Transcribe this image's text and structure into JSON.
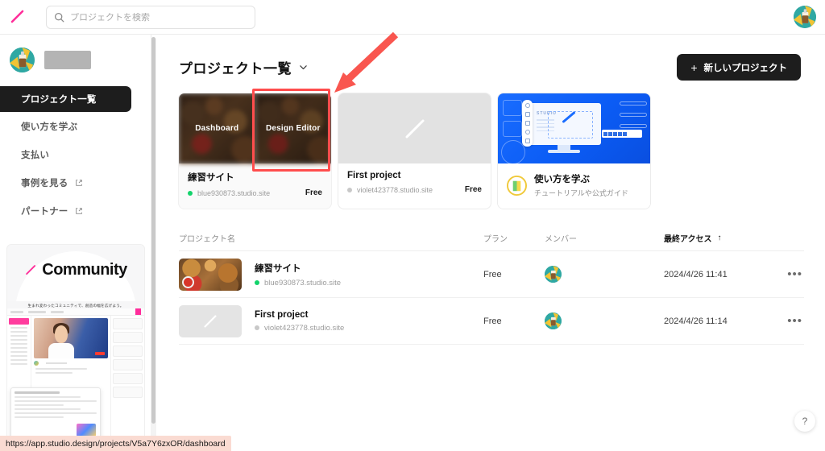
{
  "topbar": {
    "logo_icon": "studio-slash-logo",
    "search": {
      "placeholder": "プロジェクトを検索",
      "value": "",
      "icon": "search-icon"
    },
    "account_avatar": "user-avatar"
  },
  "sidebar": {
    "profile": {
      "avatar": "user-avatar",
      "name_redacted": ""
    },
    "items": [
      {
        "label": "プロジェクト一覧",
        "active": true,
        "external": false
      },
      {
        "label": "使い方を学ぶ",
        "active": false,
        "external": false
      },
      {
        "label": "支払い",
        "active": false,
        "external": false
      },
      {
        "label": "事例を見る",
        "active": false,
        "external": true
      },
      {
        "label": "パートナー",
        "active": false,
        "external": true
      }
    ],
    "promo": {
      "title": "Community",
      "subtitle": "生まれ変わったコミュニティで、創造の幅を広げよう。"
    }
  },
  "main": {
    "page_title": "プロジェクト一覧",
    "title_chevron_icon": "chevron-down-icon",
    "new_project_button": {
      "label": "新しいプロジェクト",
      "plus_icon": "+"
    },
    "cards": [
      {
        "type": "project",
        "thumb_halves": [
          "Dashboard",
          "Design Editor"
        ],
        "name": "練習サイト",
        "url": "blue930873.studio.site",
        "status": "online",
        "plan": "Free"
      },
      {
        "type": "project",
        "thumb_halves": [],
        "name": "First project",
        "url": "violet423778.studio.site",
        "status": "offline",
        "plan": "Free"
      },
      {
        "type": "tutorial",
        "title": "使い方を学ぶ",
        "subtitle": "チュートリアルや公式ガイド",
        "icon": "book-icon",
        "illustration_label": "STUDIO"
      }
    ],
    "table": {
      "headers": {
        "name": "プロジェクト名",
        "plan": "プラン",
        "member": "メンバー",
        "access": "最終アクセス",
        "sort_icon": "↑"
      },
      "rows": [
        {
          "name": "練習サイト",
          "url": "blue930873.studio.site",
          "status": "online",
          "plan": "Free",
          "member_avatar": "user-avatar",
          "last_access": "2024/4/26 11:41",
          "menu_icon": "•••"
        },
        {
          "name": "First project",
          "url": "violet423778.studio.site",
          "status": "offline",
          "plan": "Free",
          "member_avatar": "user-avatar",
          "last_access": "2024/4/26 11:14",
          "menu_icon": "•••"
        }
      ]
    }
  },
  "annotations": {
    "highlight_color": "#ff4d4d",
    "arrow_color": "#f9564f",
    "highlight_target": "Design Editor"
  },
  "statusbar": {
    "url": "https://app.studio.design/projects/V5a7Y6zxOR/dashboard"
  },
  "help_button": {
    "label": "?"
  }
}
